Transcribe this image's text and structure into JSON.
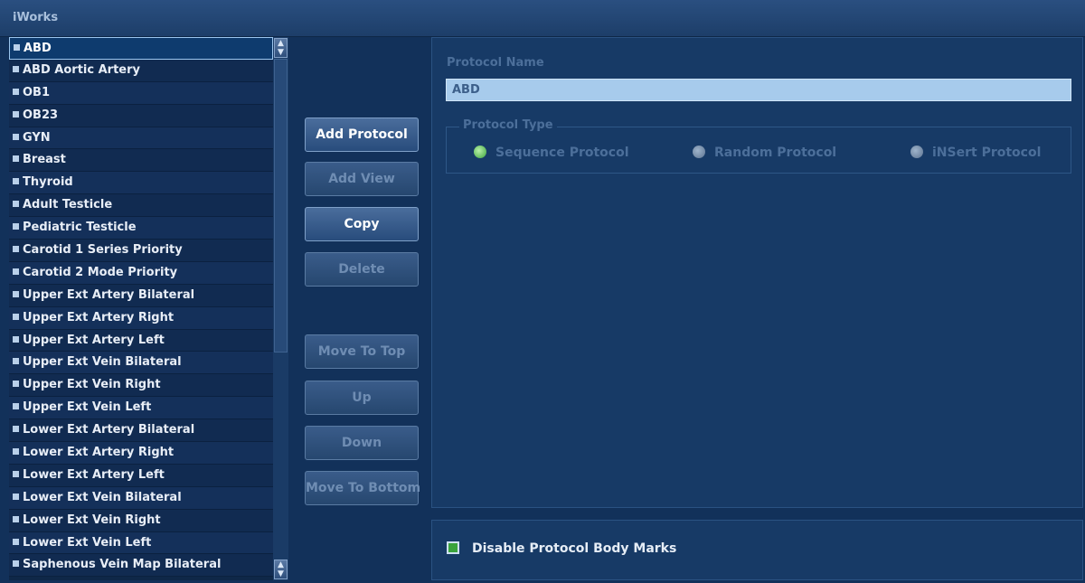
{
  "app": {
    "title": "iWorks"
  },
  "protocol_list": {
    "items": [
      {
        "label": "ABD",
        "selected": true
      },
      {
        "label": "ABD Aortic Artery"
      },
      {
        "label": "OB1"
      },
      {
        "label": "OB23"
      },
      {
        "label": "GYN"
      },
      {
        "label": "Breast"
      },
      {
        "label": "Thyroid"
      },
      {
        "label": "Adult Testicle"
      },
      {
        "label": "Pediatric Testicle"
      },
      {
        "label": "Carotid 1 Series Priority"
      },
      {
        "label": "Carotid 2 Mode Priority"
      },
      {
        "label": "Upper Ext Artery Bilateral"
      },
      {
        "label": "Upper Ext Artery Right"
      },
      {
        "label": "Upper Ext Artery Left"
      },
      {
        "label": "Upper Ext Vein Bilateral"
      },
      {
        "label": "Upper Ext Vein Right"
      },
      {
        "label": "Upper Ext Vein Left"
      },
      {
        "label": "Lower Ext Artery Bilateral"
      },
      {
        "label": "Lower Ext Artery Right"
      },
      {
        "label": "Lower Ext Artery Left"
      },
      {
        "label": "Lower Ext Vein Bilateral"
      },
      {
        "label": "Lower Ext Vein Right"
      },
      {
        "label": "Lower Ext Vein Left"
      },
      {
        "label": "Saphenous Vein Map Bilateral"
      }
    ]
  },
  "buttons": {
    "add_protocol": "Add Protocol",
    "add_view": "Add View",
    "copy": "Copy",
    "delete": "Delete",
    "move_to_top": "Move To Top",
    "up": "Up",
    "down": "Down",
    "move_to_bottom": "Move To Bottom"
  },
  "protocol": {
    "name_label": "Protocol Name",
    "name_value": "ABD",
    "type_label": "Protocol Type",
    "types": [
      {
        "label": "Sequence Protocol",
        "checked": true
      },
      {
        "label": "Random Protocol",
        "checked": false
      },
      {
        "label": "iNSert Protocol",
        "checked": false
      }
    ]
  },
  "body_marks": {
    "label": "Disable Protocol Body Marks",
    "checked": true
  },
  "colors": {
    "background": "#12315a",
    "accent_green": "#3aa33c",
    "input_fill": "#a7cbec"
  }
}
